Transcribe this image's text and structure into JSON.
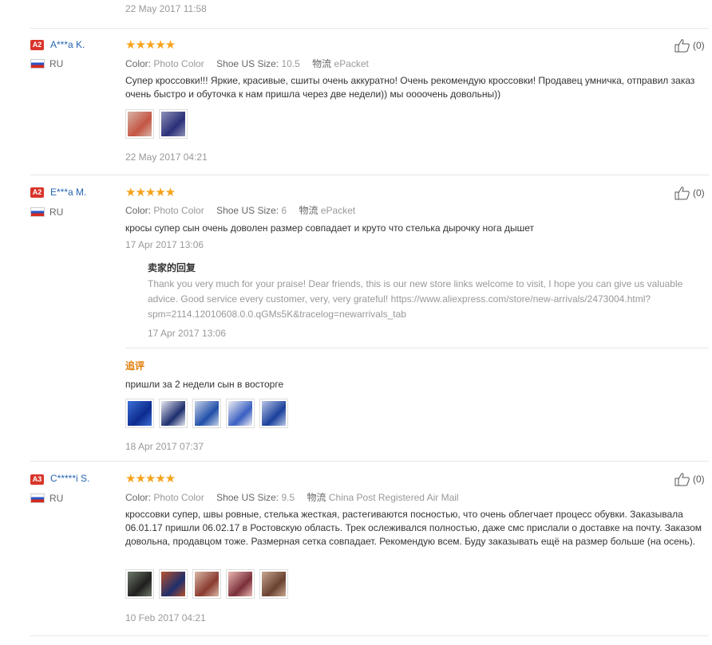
{
  "top_date": "22 May 2017 11:58",
  "reviews": [
    {
      "badge": "A2",
      "name": "A***a K.",
      "country": "RU",
      "stars": "★★★★★",
      "color_label": "Color:",
      "color_value": "Photo Color",
      "size_label": "Shoe US Size:",
      "size_value": "10.5",
      "ship_label": "物流",
      "ship_value": "ePacket",
      "text": "Супер кроссовки!!! Яркие, красивые, сшиты очень аккуратно! Очень рекомендую кроссовки! Продавец умничка, отправил заказ очень быстро и обуточка к нам пришла через две недели)) мы оооочень довольны))",
      "date": "22 May 2017 04:21",
      "helpful": "(0)",
      "images": [
        [
          "#d7b4a8",
          "#c45543"
        ],
        [
          "#8f90b8",
          "#2a2f77"
        ]
      ]
    },
    {
      "badge": "A2",
      "name": "E***a M.",
      "country": "RU",
      "stars": "★★★★★",
      "color_label": "Color:",
      "color_value": "Photo Color",
      "size_label": "Shoe US Size:",
      "size_value": "6",
      "ship_label": "物流",
      "ship_value": "ePacket",
      "text": "кросы супер сын очень доволен размер совпадает и круто что стелька дырочку нога дышет",
      "date": "17 Apr 2017 13:06",
      "helpful": "(0)",
      "reply": {
        "title": "卖家的回复",
        "text": "Thank you very much for your praise! Dear friends, this is our new store links welcome to visit, I hope you can give us valuable advice. Good service every customer, very, very grateful! https://www.aliexpress.com/store/new-arrivals/2473004.html?spm=2114.12010608.0.0.qGMs5K&tracelog=newarrivals_tab",
        "date": "17 Apr 2017 13:06"
      },
      "followup": {
        "label": "追评",
        "text": "пришли за 2 недели сын в восторге",
        "date": "18 Apr 2017 07:37",
        "images": [
          [
            "#3d6fd6",
            "#0c2b8f"
          ],
          [
            "#e8e8f0",
            "#1d2e6e"
          ],
          [
            "#c9d3e8",
            "#1f4fa8"
          ],
          [
            "#f0f0f4",
            "#3a5fc2"
          ],
          [
            "#b9c6e6",
            "#1a3f9a"
          ]
        ]
      }
    },
    {
      "badge": "A3",
      "name": "C*****i S.",
      "country": "RU",
      "stars": "★★★★★",
      "color_label": "Color:",
      "color_value": "Photo Color",
      "size_label": "Shoe US Size:",
      "size_value": "9.5",
      "ship_label": "物流",
      "ship_value": "China Post Registered Air Mail",
      "text": "кроссовки супер, швы ровные, стелька жесткая, растегиваются посностью, что очень облегчает процесс обувки. Заказывала 06.01.17 пришли 06.02.17 в Ростовскую область. Трек ослеживался полностью, даже смс прислали о доставке на почту. Заказом довольна, продавцом тоже. Размерная сетка совпадает. Рекомендую всем. Буду заказывать ещё на размер больше (на осень).",
      "date": "10 Feb 2017 04:21",
      "helpful": "(0)",
      "images": [
        [
          "#6f7a6a",
          "#1f1f1f"
        ],
        [
          "#b8522f",
          "#1f2f6a"
        ],
        [
          "#d9b8a8",
          "#8a3a2f"
        ],
        [
          "#e8b7b0",
          "#7a2f3a"
        ],
        [
          "#c8a890",
          "#6a4030"
        ]
      ]
    }
  ]
}
